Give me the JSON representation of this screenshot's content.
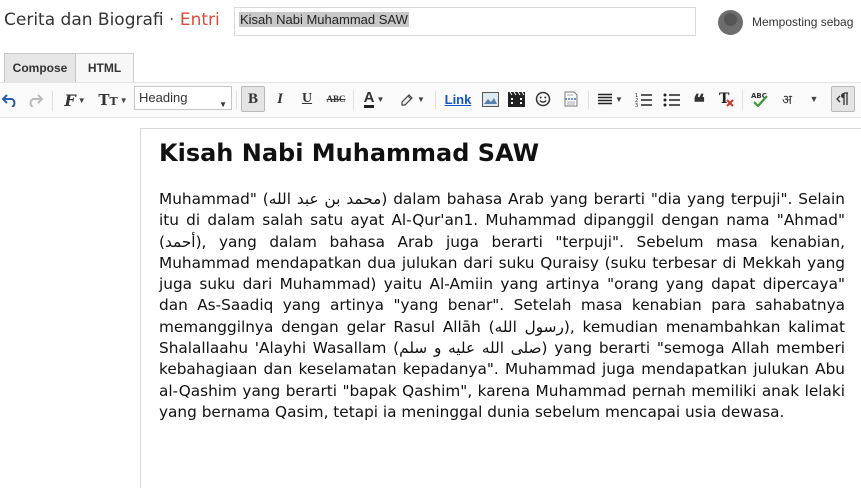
{
  "header": {
    "blog_name": "Cerita dan Biografi",
    "separator": "·",
    "section": "Entri",
    "post_title_value": "Kisah Nabi Muhammad SAW",
    "publishing_as": "Memposting sebag"
  },
  "tabs": [
    {
      "label": "Compose",
      "active": true
    },
    {
      "label": "HTML",
      "active": false
    }
  ],
  "toolbar": {
    "format_select_value": "Heading",
    "bold_label": "B",
    "italic_label": "I",
    "underline_label": "U",
    "strike_label": "ABC",
    "text_color_label": "A",
    "link_label": "Link",
    "transliterate_label": "अ",
    "icons": [
      "undo-icon",
      "redo-icon",
      "font-family-icon",
      "font-size-icon",
      "bold-icon",
      "italic-icon",
      "underline-icon",
      "strikethrough-icon",
      "text-color-icon",
      "highlight-icon",
      "link-icon",
      "image-icon",
      "video-icon",
      "emoji-icon",
      "jump-break-icon",
      "align-icon",
      "numbered-list-icon",
      "bullet-list-icon",
      "quote-icon",
      "clear-format-icon",
      "spellcheck-icon",
      "transliterate-icon",
      "more-icon",
      "rtl-icon"
    ]
  },
  "post": {
    "heading": "Kisah Nabi Muhammad SAW",
    "body": "Muhammad\" (محمد بن عبد الله) dalam bahasa Arab yang berarti \"dia yang terpuji\". Selain itu di dalam salah satu ayat Al-Qur'an1. Muhammad dipanggil dengan nama \"Ahmad\" (أحمد), yang dalam bahasa Arab juga berarti \"terpuji\". Sebelum masa kenabian, Muhammad mendapatkan dua julukan dari suku Quraisy (suku terbesar di Mekkah yang juga suku dari Muhammad) yaitu Al-Amiin yang artinya \"orang yang dapat dipercaya\" dan As-Saadiq yang artinya \"yang benar\". Setelah masa kenabian para sahabatnya memanggilnya dengan gelar Rasul Allāh (رسول الله), kemudian menambahkan kalimat Shalallaahu 'Alayhi Wasallam (صلى الله عليه و سلم) yang berarti \"semoga Allah memberi kebahagiaan dan keselamatan kepadanya\". Muhammad juga mendapatkan julukan Abu al-Qashim yang berarti \"bapak Qashim\", karena Muhammad pernah memiliki anak lelaki yang bernama Qasim, tetapi ia meninggal dunia sebelum mencapai usia dewasa."
  },
  "colors": {
    "accent": "#dd4b39",
    "link": "#1155cc",
    "spellcheck": "#e23a2a"
  }
}
